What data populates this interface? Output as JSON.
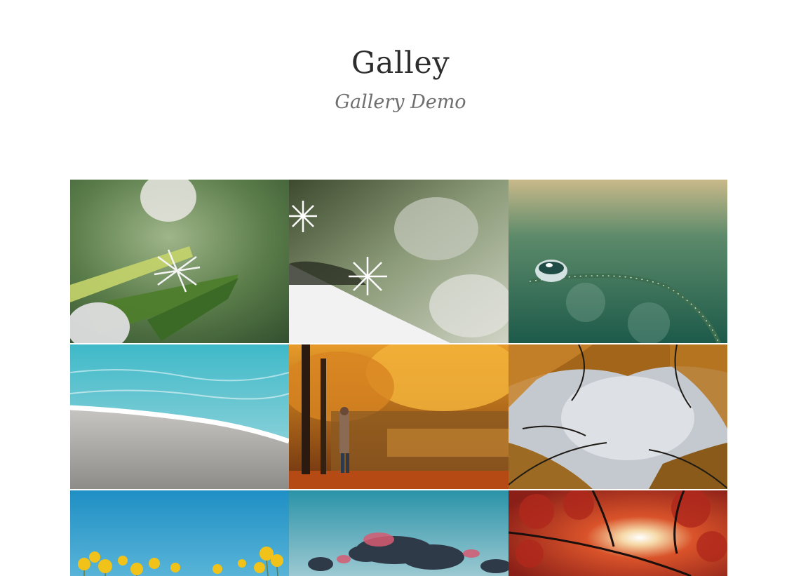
{
  "site": {
    "title": "Galley",
    "tagline": "Gallery Demo"
  },
  "gallery": {
    "images": [
      {
        "subject": "snowflake on green leaf"
      },
      {
        "subject": "snowflakes on snowy branch"
      },
      {
        "subject": "water droplet on grass blade"
      },
      {
        "subject": "sea wave on sandy beach"
      },
      {
        "subject": "person in autumn forest by lake"
      },
      {
        "subject": "autumn tree canopy against sky"
      },
      {
        "subject": "yellow flowers against blue sky"
      },
      {
        "subject": "dark and pink clouds in blue sky"
      },
      {
        "subject": "red autumn leaves with sunburst"
      }
    ]
  },
  "colors": {
    "background": "#ffffff",
    "title": "#2d2d2d",
    "tagline": "#6f6f6f"
  }
}
